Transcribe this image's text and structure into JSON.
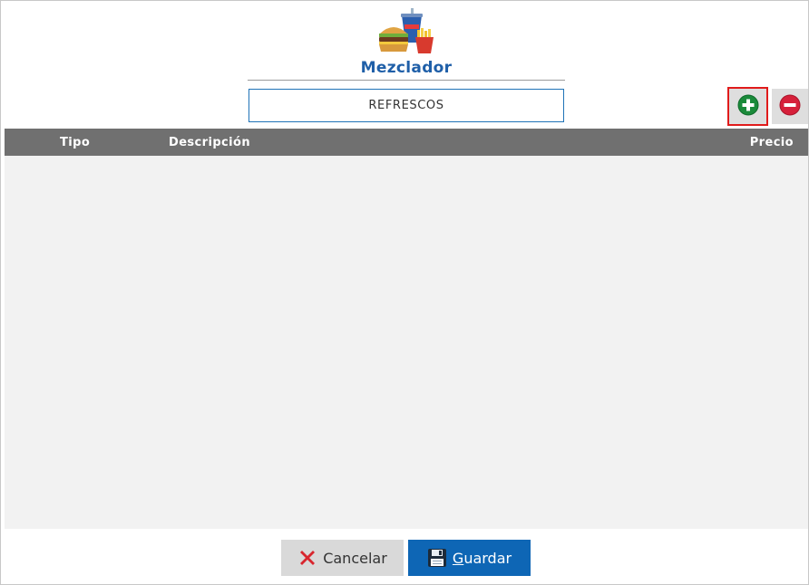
{
  "dialog": {
    "title": "Mezclador",
    "logo_icon": "burger-drink-fries-icon",
    "selected_category": "REFRESCOS"
  },
  "toolbar": {
    "add_icon": "plus-circle-icon",
    "remove_icon": "minus-circle-icon"
  },
  "table": {
    "columns": [
      "Tipo",
      "Descripción",
      "Precio"
    ],
    "rows": []
  },
  "footer": {
    "cancel_label": "Cancelar",
    "save_label_first": "G",
    "save_label_rest": "uardar"
  },
  "colors": {
    "accent_blue": "#0e66b5",
    "header_gray": "#707070",
    "highlight_red": "#e01b1b",
    "add_green": "#1a8a3a",
    "remove_red": "#d6203a"
  }
}
